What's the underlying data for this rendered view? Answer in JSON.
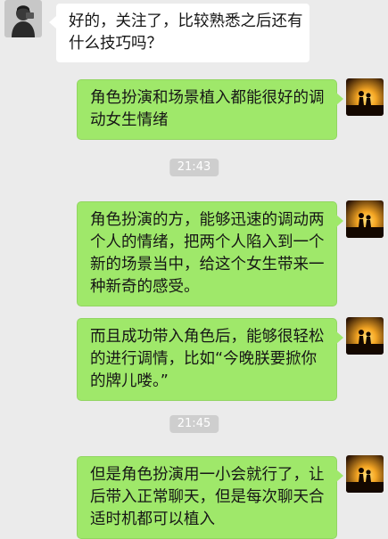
{
  "messages": [
    {
      "side": "in",
      "lines": [
        "好的，关注了，比较熟悉之后还有",
        "什么技巧吗？"
      ]
    },
    {
      "side": "out",
      "lines": [
        "角色扮演和场景植入都能很好的调",
        "动女生情绪"
      ]
    },
    {
      "side": "time",
      "text": "21:43"
    },
    {
      "side": "out",
      "lines": [
        "角色扮演的方，能够迅速的调动两",
        "个人的情绪，把两个人陷入到一个",
        "新的场景当中，给这个女生带来一",
        "种新奇的感受。"
      ]
    },
    {
      "side": "out",
      "lines": [
        "而且成功带入角色后，能够很轻松",
        "的进行调情，比如“今晚朕要掀你",
        "的牌儿喽。”"
      ]
    },
    {
      "side": "time",
      "text": "21:45"
    },
    {
      "side": "out",
      "lines": [
        "但是角色扮演用一小会就行了，让",
        "后带入正常聊天，但是每次聊天合",
        "适时机都可以植入"
      ]
    }
  ],
  "colors": {
    "background": "#ebebeb",
    "sent_bubble": "#9fe86a",
    "received_bubble": "#ffffff",
    "timestamp_bg": "#cecece"
  },
  "icons": {
    "sender_avatar": "person-avatar-icon",
    "self_avatar": "sunset-couple-avatar-icon"
  }
}
